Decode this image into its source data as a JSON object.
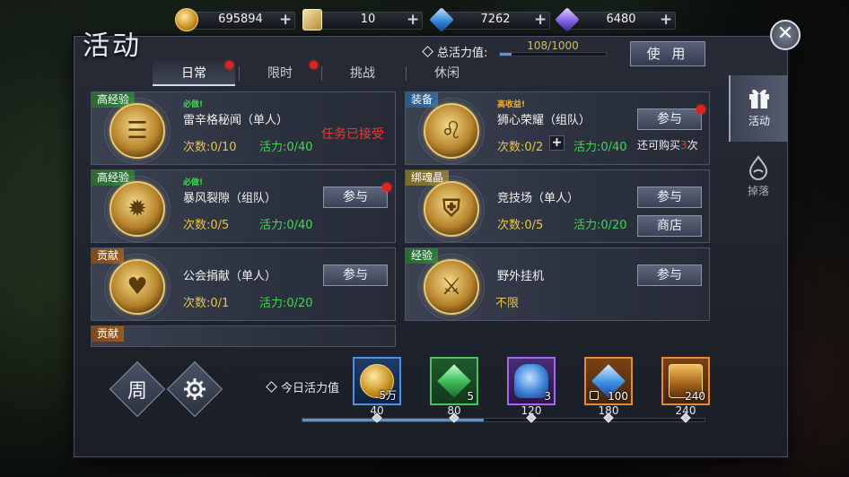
{
  "resources": [
    {
      "name": "gold-coin",
      "icon": "gold-coin-icon",
      "value": "695894"
    },
    {
      "name": "scroll",
      "icon": "scroll-icon",
      "value": "10"
    },
    {
      "name": "blue-crystal",
      "icon": "blue-crystal-icon",
      "value": "7262"
    },
    {
      "name": "purple-gem",
      "icon": "purple-gem-icon",
      "value": "6480"
    }
  ],
  "plus": "+",
  "window": {
    "title": "活动",
    "close": "✕"
  },
  "vitality": {
    "label": "总活力值:",
    "value": "108/1000",
    "current": 108,
    "max": 1000,
    "use_label": "使 用"
  },
  "tabs": [
    {
      "label": "日常",
      "active": true,
      "dot": true
    },
    {
      "label": "限时",
      "active": false,
      "dot": true
    },
    {
      "label": "挑战",
      "active": false,
      "dot": false
    },
    {
      "label": "休闲",
      "active": false,
      "dot": false
    }
  ],
  "sidenav": [
    {
      "label": "活动",
      "icon": "gift-icon",
      "active": true
    },
    {
      "label": "掉落",
      "icon": "drop-icon",
      "active": false
    }
  ],
  "activities": [
    {
      "tag": "高经验",
      "tag_color": "green",
      "must": "必做!",
      "must_color": "green",
      "name": "雷辛格秘闻（单人）",
      "count": "次数:0/10",
      "vitality": "活力:0/40",
      "status": "任务已接受",
      "emblem": "☰"
    },
    {
      "tag": "装备",
      "tag_color": "blue",
      "must": "高收益!",
      "must_color": "gold",
      "name": "狮心荣耀（组队）",
      "count": "次数:0/2",
      "vitality": "活力:0/40",
      "button": "参与",
      "button_dot": true,
      "buy_prefix": "还可购买",
      "buy_count": "3",
      "buy_suffix": "次",
      "emblem": "♌"
    },
    {
      "tag": "高经验",
      "tag_color": "green",
      "must": "必做!",
      "must_color": "green",
      "name": "暴风裂隙（组队）",
      "count": "次数:0/5",
      "vitality": "活力:0/40",
      "button": "参与",
      "button_dot": true,
      "emblem": "✹"
    },
    {
      "tag": "绑魂晶",
      "tag_color": "olive",
      "name": "竞技场（单人）",
      "count": "次数:0/5",
      "vitality": "活力:0/20",
      "button": "参与",
      "shop": "商店",
      "emblem": "⛨"
    },
    {
      "tag": "贡献",
      "tag_color": "brown",
      "name": "公会捐献（单人）",
      "count": "次数:0/1",
      "vitality": "活力:0/20",
      "button": "参与",
      "emblem": "♥"
    },
    {
      "tag": "经验",
      "tag_color": "green",
      "name": "野外挂机",
      "unlimited": "不限",
      "button": "参与",
      "emblem": "⚔"
    },
    {
      "tag": "贡献",
      "tag_color": "brown"
    }
  ],
  "bottom": {
    "week_label": "周",
    "settings_icon": "gear-icon",
    "today_label": "今日活力值",
    "progress": 108,
    "progress_max": 240,
    "rewards": [
      {
        "qty": "5万",
        "milestone": "40",
        "style": "blue",
        "icon": "gold-coin-icon",
        "locked": false
      },
      {
        "qty": "5",
        "milestone": "80",
        "style": "green",
        "icon": "green-crystal-icon",
        "locked": false
      },
      {
        "qty": "3",
        "milestone": "120",
        "style": "purple",
        "icon": "blue-beast-icon",
        "locked": false
      },
      {
        "qty": "100",
        "milestone": "180",
        "style": "orange",
        "icon": "blue-crystal-icon",
        "locked": true
      },
      {
        "qty": "240",
        "milestone": "240",
        "style": "orange2",
        "icon": "treasure-chest-icon",
        "locked": false
      }
    ]
  },
  "colors": {
    "accent_blue": "#5a93d6",
    "red_dot": "#e0231c",
    "gold_text": "#e8c44a",
    "green_text": "#3ed850",
    "red_text": "#e63c32"
  }
}
